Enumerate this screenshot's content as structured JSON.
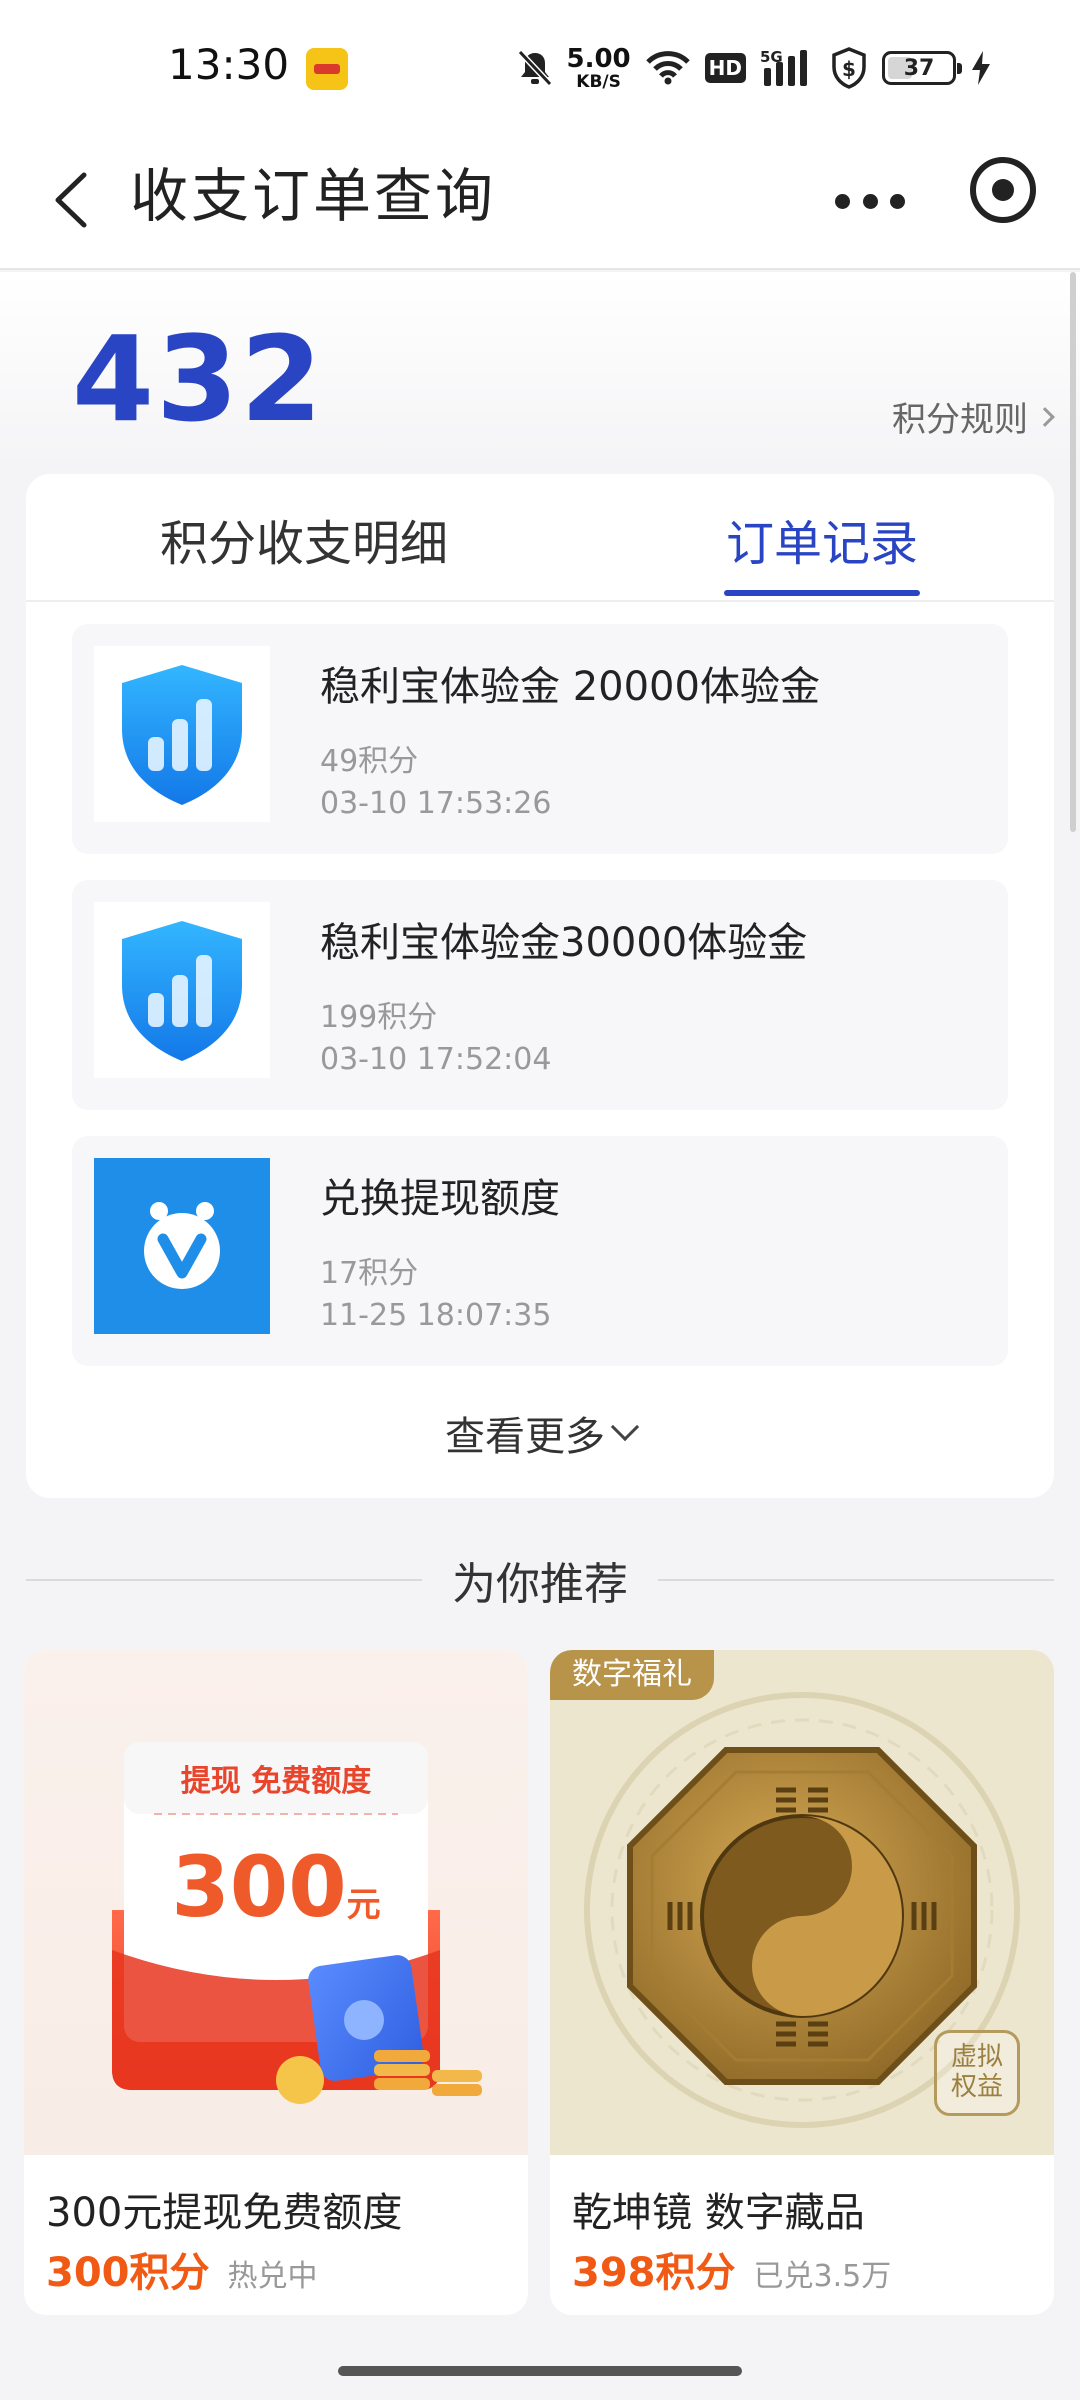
{
  "status_bar": {
    "time": "13:30",
    "net_speed_value": "5.00",
    "net_speed_unit": "KB/S",
    "hd": "HD",
    "signal_label": "5G",
    "battery": "37",
    "icons": [
      "app-notification-icon",
      "mute-bell-icon",
      "wifi-icon",
      "hd-icon",
      "signal-5g-icon",
      "shield-dollar-icon",
      "battery-icon",
      "charging-icon"
    ]
  },
  "nav": {
    "title": "收支订单查询"
  },
  "points": {
    "value": "432",
    "rules_link": "积分规则"
  },
  "tabs": [
    {
      "label": "积分收支明细",
      "active": false
    },
    {
      "label": "订单记录",
      "active": true
    }
  ],
  "orders": [
    {
      "title": "稳利宝体验金 20000体验金",
      "points": "49积分",
      "time": "03-10 17:53:26",
      "icon": "shield-chart-icon"
    },
    {
      "title": "稳利宝体验金30000体验金",
      "points": "199积分",
      "time": "03-10 17:52:04",
      "icon": "shield-chart-icon"
    },
    {
      "title": "兑换提现额度",
      "points": "17积分",
      "time": "11-25 18:07:35",
      "icon": "v-logo-icon"
    }
  ],
  "see_more": "查看更多",
  "recommend": {
    "heading": "为你推荐",
    "products": [
      {
        "name": "300元提现免费额度",
        "points": "300积分",
        "status": "热兑中",
        "image_caption": "提现 免费额度",
        "image_amount": "300",
        "image_unit": "元"
      },
      {
        "name": "乾坤镜 数字藏品",
        "points": "398积分",
        "status": "已兑3.5万",
        "badge": "数字福礼",
        "corner_badge": "虚拟\n权益"
      }
    ]
  },
  "colors": {
    "accent": "#2a45c4",
    "price": "#f05a14",
    "badge_gold": "#b8944a"
  }
}
